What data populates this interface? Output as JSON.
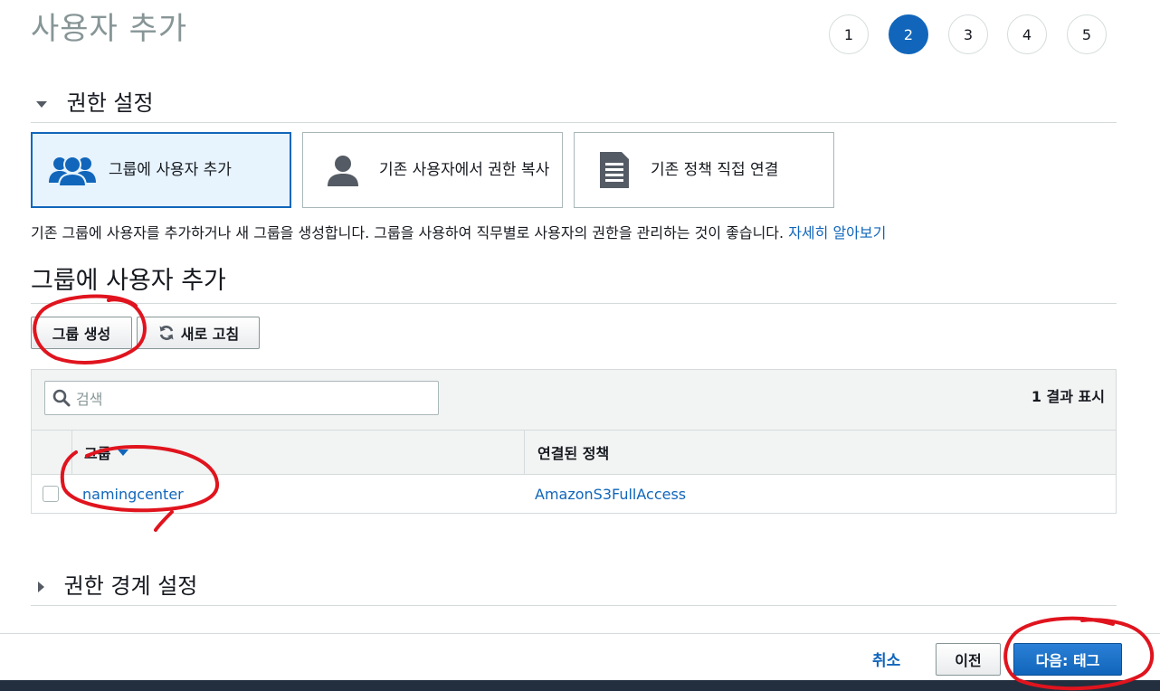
{
  "page": {
    "title": "사용자 추가"
  },
  "steps": [
    "1",
    "2",
    "3",
    "4",
    "5"
  ],
  "active_step": "2",
  "permissions": {
    "heading": "권한 설정",
    "options": [
      {
        "label": "그룹에 사용자 추가",
        "icon": "users-group-icon",
        "selected": true
      },
      {
        "label": "기존 사용자에서 권한 복사",
        "icon": "user-icon",
        "selected": false
      },
      {
        "label": "기존 정책 직접 연결",
        "icon": "document-icon",
        "selected": false
      }
    ],
    "description": "기존 그룹에 사용자를 추가하거나 새 그룹을 생성합니다. 그룹을 사용하여 직무별로 사용자의 권한을 관리하는 것이 좋습니다.",
    "learn_more": "자세히 알아보기"
  },
  "groups": {
    "heading": "그룹에 사용자 추가",
    "create_button": "그룹 생성",
    "refresh_button": "새로 고침",
    "search_placeholder": "검색",
    "result_count": "1 결과 표시",
    "columns": [
      "그룹",
      "연결된 정책"
    ],
    "rows": [
      {
        "group": "namingcenter",
        "policy": "AmazonS3FullAccess"
      }
    ]
  },
  "boundary": {
    "heading": "권한 경계 설정"
  },
  "footer": {
    "cancel": "취소",
    "previous": "이전",
    "next": "다음: 태그"
  },
  "colors": {
    "accent": "#1166bb",
    "annotation": "#e0141e",
    "footer_bar": "#232f3e"
  }
}
